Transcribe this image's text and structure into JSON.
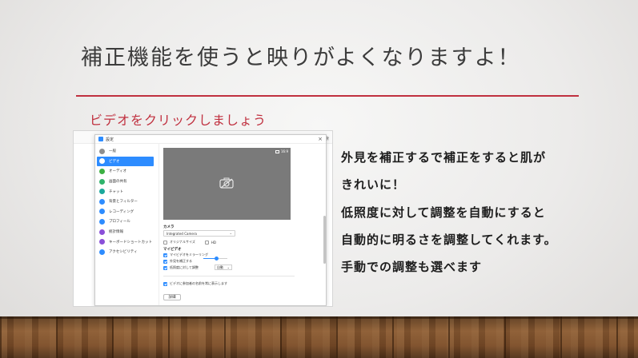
{
  "slide": {
    "title": "補正機能を使うと映りがよくなりますよ！",
    "subtitle": "ビデオをクリックしましょう",
    "accent_color": "#c0303f"
  },
  "screenshot": {
    "background_search": "検索",
    "dialog": {
      "title": "設定",
      "sidebar": [
        {
          "label": "一般",
          "icon": "gear-icon",
          "color": "#8e8e8e",
          "active": false
        },
        {
          "label": "ビデオ",
          "icon": "video-icon",
          "color": "#2d8cff",
          "active": true
        },
        {
          "label": "オーディオ",
          "icon": "headphones-icon",
          "color": "#3cb043",
          "active": false
        },
        {
          "label": "画面の共有",
          "icon": "share-screen-icon",
          "color": "#2fb36b",
          "active": false
        },
        {
          "label": "チャット",
          "icon": "chat-icon",
          "color": "#1aa89b",
          "active": false
        },
        {
          "label": "背景とフィルター",
          "icon": "background-icon",
          "color": "#2d8cff",
          "active": false
        },
        {
          "label": "レコーディング",
          "icon": "record-icon",
          "color": "#2d8cff",
          "active": false
        },
        {
          "label": "プロフィール",
          "icon": "profile-icon",
          "color": "#2d8cff",
          "active": false
        },
        {
          "label": "統計情報",
          "icon": "stats-icon",
          "color": "#8a4fd8",
          "active": false
        },
        {
          "label": "キーボードショートカット",
          "icon": "keyboard-icon",
          "color": "#8a4fd8",
          "active": false
        },
        {
          "label": "アクセシビリティ",
          "icon": "accessibility-icon",
          "color": "#2d8cff",
          "active": false
        }
      ],
      "preview_badge": "16:9",
      "camera_label": "カメラ",
      "camera_value": "Integrated Camera",
      "original_size_label": "オリジナルサイズ",
      "hd_label": "HD",
      "my_video_label": "マイビデオ",
      "mirror_label": "マイビデオをミラーリング",
      "touch_up_label": "外見を補正する",
      "low_light_label": "低照度に対して調整",
      "low_light_value": "自動",
      "show_names_label": "ビデオに参加者の名前を常に表示します",
      "detail_button": "詳細",
      "touch_up_level": 0.55,
      "checkboxes": {
        "original_size": false,
        "hd": false,
        "mirror": true,
        "touch_up": true,
        "low_light": true,
        "show_names": true
      }
    }
  },
  "explanation": [
    "外見を補正するで補正をすると肌が",
    "きれいに！",
    "低照度に対して調整を自動にすると",
    "自動的に明るさを調整してくれます。",
    "手動での調整も選べます"
  ]
}
